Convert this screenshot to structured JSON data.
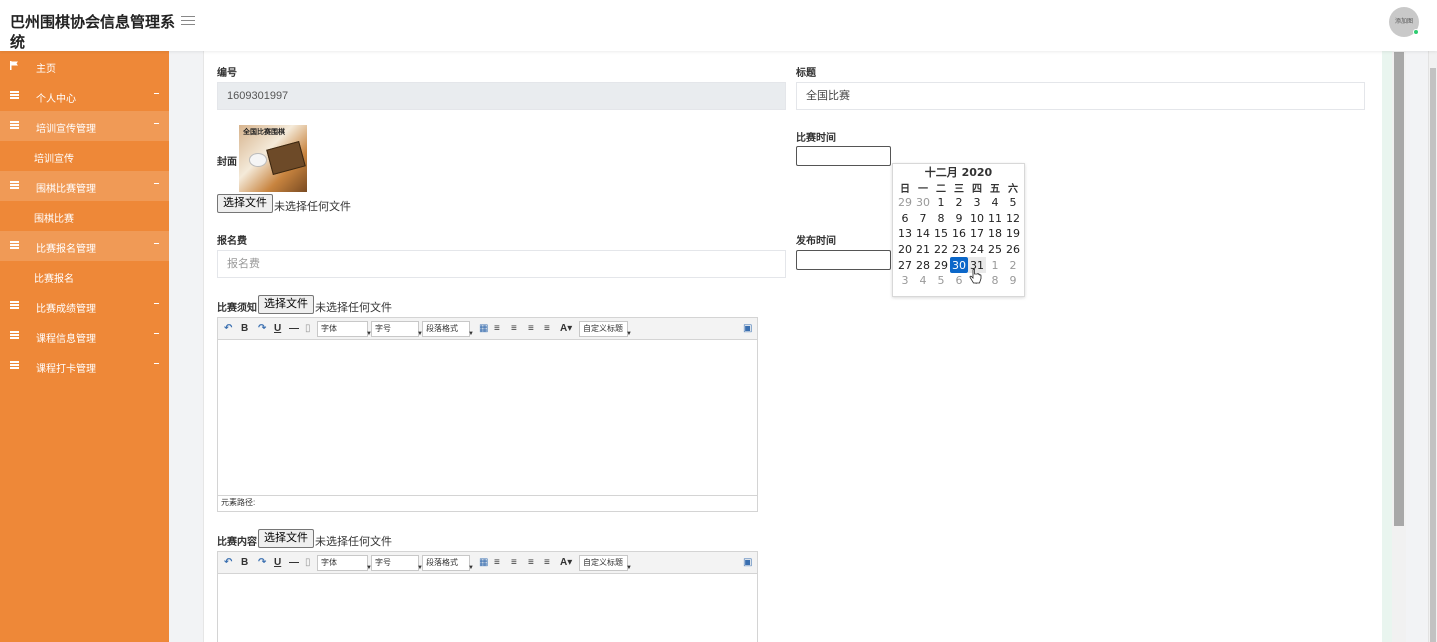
{
  "header": {
    "app_title": "巴州围棋协会信息管理系统",
    "menu_icon": "hamburger-icon",
    "avatar_text": "添加图"
  },
  "sidebar": {
    "items": [
      {
        "label": "主页",
        "icon": "flag-icon"
      },
      {
        "label": "个人中心",
        "icon": "grid-icon"
      },
      {
        "label": "培训宣传管理",
        "icon": "grid-icon",
        "sub": "培训宣传"
      },
      {
        "label": "围棋比赛管理",
        "icon": "grid-icon",
        "sub": "围棋比赛"
      },
      {
        "label": "比赛报名管理",
        "icon": "grid-icon",
        "sub": "比赛报名"
      },
      {
        "label": "比赛成绩管理",
        "icon": "grid-icon"
      },
      {
        "label": "课程信息管理",
        "icon": "grid-icon"
      },
      {
        "label": "课程打卡管理",
        "icon": "grid-icon"
      }
    ]
  },
  "form": {
    "number_label": "编号",
    "number_value": "1609301997",
    "title_label": "标题",
    "title_value": "全国比赛",
    "cover_label": "封面",
    "cover_image_text": "全国比赛围棋",
    "file_button": "选择文件",
    "file_none": "未选择任何文件",
    "match_time_label": "比赛时间",
    "fee_label": "报名费",
    "fee_placeholder": "报名费",
    "publish_time_label": "发布时间",
    "notice_label": "比赛须知",
    "content_label": "比赛内容"
  },
  "editor": {
    "font_family": "字体",
    "font_size": "字号",
    "paragraph": "段落格式",
    "custom_title": "自定义标题",
    "element_path": "元素路径:"
  },
  "calendar": {
    "caption": "十二月 2020",
    "weekdays": [
      "日",
      "一",
      "二",
      "三",
      "四",
      "五",
      "六"
    ],
    "weeks": [
      [
        "29",
        "30",
        "1",
        "2",
        "3",
        "4",
        "5"
      ],
      [
        "6",
        "7",
        "8",
        "9",
        "10",
        "11",
        "12"
      ],
      [
        "13",
        "14",
        "15",
        "16",
        "17",
        "18",
        "19"
      ],
      [
        "20",
        "21",
        "22",
        "23",
        "24",
        "25",
        "26"
      ],
      [
        "27",
        "28",
        "29",
        "30",
        "31",
        "1",
        "2"
      ],
      [
        "3",
        "4",
        "5",
        "6",
        "7",
        "8",
        "9"
      ]
    ],
    "selected": "30",
    "hovered": "31"
  },
  "colors": {
    "sidebar": "#ee8838",
    "sidebar_open": "#f09a56",
    "selected_day": "#0b67c9"
  }
}
